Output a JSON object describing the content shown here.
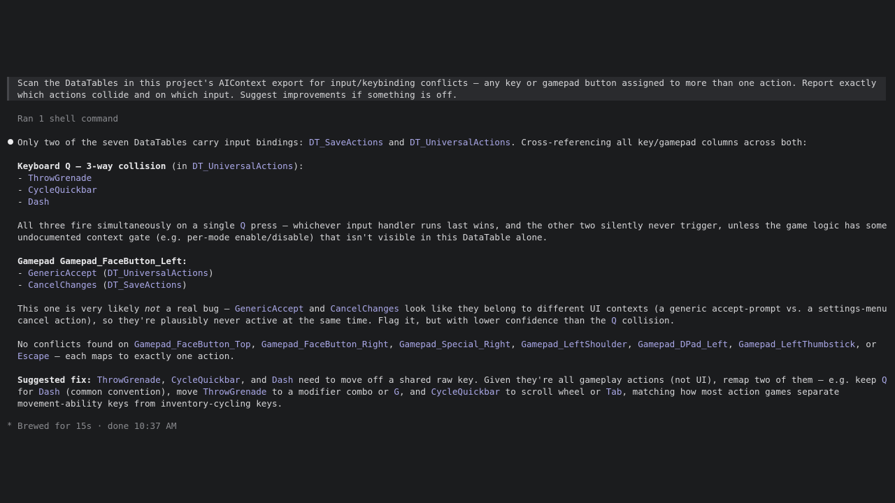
{
  "prompt": {
    "line1": "Scan the DataTables in this project's AIContext export for input/keybinding conflicts — any key or gamepad button assigned to more than one action. Report exactly",
    "line2": "which actions collide and on which input. Suggest improvements if something is off."
  },
  "tool": {
    "summary": "Ran 1 shell command"
  },
  "response": {
    "intro": {
      "a": "Only two of the seven DataTables carry input bindings: ",
      "t1": "DT_SaveActions",
      "b": " and ",
      "t2": "DT_UniversalActions",
      "c": ". Cross-referencing all key/gamepad columns across both:"
    },
    "kb": {
      "pre": "Keyboard ",
      "key": "Q",
      "post": " — 3-way collision",
      "in_open": " (in ",
      "table": "DT_UniversalActions",
      "in_close": "):",
      "items": [
        "ThrowGrenade",
        "CycleQuickbar",
        "Dash"
      ]
    },
    "kb_note": {
      "l1a": "All three fire simultaneously on a single ",
      "l1key": "Q",
      "l1b": " press — whichever input handler runs last wins, and the other two silently never trigger, unless the game logic has some",
      "l2": "undocumented context gate (e.g. per-mode enable/disable) that isn't visible in this DataTable alone."
    },
    "gp": {
      "pre": "Gamepad ",
      "button": "Gamepad_FaceButton_Left",
      "post": ":",
      "items": [
        {
          "action": "GenericAccept",
          "table": "DT_UniversalActions"
        },
        {
          "action": "CancelChanges",
          "table": "DT_SaveActions"
        }
      ]
    },
    "gp_note": {
      "a": "This one is very likely ",
      "em": "not",
      "b": " a real bug — ",
      "t1": "GenericAccept",
      "c": " and ",
      "t2": "CancelChanges",
      "d": " look like they belong to different UI contexts (a generic accept-prompt vs. a settings-menu",
      "l2a": "cancel action), so they're plausibly never active at the same time. Flag it, but with lower confidence than the ",
      "l2key": "Q",
      "l2b": " collision."
    },
    "noconf": {
      "a": "No conflicts found on ",
      "inputs": [
        "Gamepad_FaceButton_Top",
        "Gamepad_FaceButton_Right",
        "Gamepad_Special_Right",
        "Gamepad_LeftShoulder",
        "Gamepad_DPad_Left",
        "Gamepad_LeftThumbstick"
      ],
      "or": ", or",
      "last": "Escape",
      "tail": " — each maps to exactly one action."
    },
    "fix": {
      "label": "Suggested fix:",
      "a1": "ThrowGrenade",
      "a2": "CycleQuickbar",
      "and": ", and ",
      "a3": "Dash",
      "b": " need to move off a shared raw key. Given they're all gameplay actions (not UI), remap two of them — e.g. keep ",
      "k1": "Q",
      "l2pre": "for ",
      "l2dash": "Dash",
      "l2b": " (common convention), move ",
      "l2tg": "ThrowGrenade",
      "l2c": " to a modifier combo or ",
      "l2g": "G",
      "l2d": ", and ",
      "l2cq": "CycleQuickbar",
      "l2e": " to scroll wheel or ",
      "l2tab": "Tab",
      "l2f": ", matching how most action games separate",
      "l3": "movement-ability keys from inventory-cycling keys."
    }
  },
  "status": {
    "icon": "*",
    "text": "Brewed for 15s · done 10:37 AM"
  }
}
